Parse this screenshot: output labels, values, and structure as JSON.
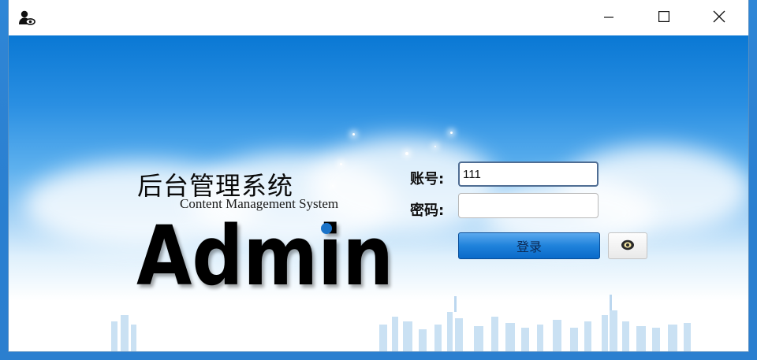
{
  "window": {
    "app_icon": "user-eye-icon",
    "controls": {
      "minimize": "minimize-icon",
      "maximize": "maximize-icon",
      "close": "close-icon"
    }
  },
  "branding": {
    "title": "后台管理系统",
    "subtitle": "Content Management System",
    "logo_text": "Admin",
    "accent_color": "#1a73c8"
  },
  "form": {
    "account_label": "账号:",
    "account_value": "111",
    "password_label": "密码:",
    "password_value": "",
    "login_label": "登录",
    "toggle_icon": "eye-icon"
  },
  "colors": {
    "sky_top": "#0a78d4",
    "button_blue": "#1f82db",
    "desktop": "#2b7fcf"
  }
}
